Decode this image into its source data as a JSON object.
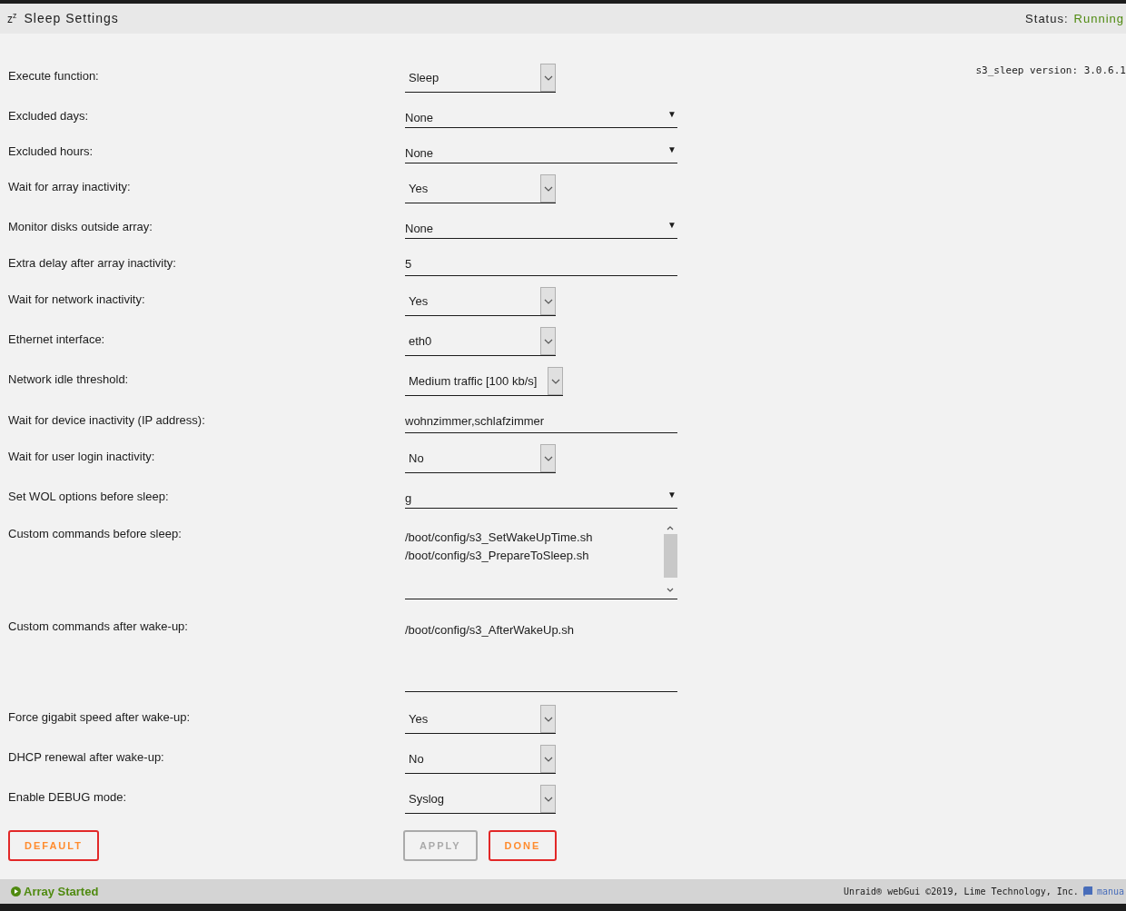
{
  "header": {
    "icon": "z$^{z}$",
    "title": "Sleep Settings",
    "status_label": "Status:",
    "status_value": "Running"
  },
  "version": "s3_sleep version: 3.0.6.1",
  "settings": [
    {
      "label": "Execute function:",
      "kind": "select",
      "value": "Sleep"
    },
    {
      "label": "Excluded days:",
      "kind": "multiselect",
      "value": "None",
      "arrow": "▼"
    },
    {
      "label": "Excluded hours:",
      "kind": "multiselect",
      "value": "None",
      "arrow": "▼"
    },
    {
      "label": "Wait for array inactivity:",
      "kind": "select",
      "value": "Yes"
    },
    {
      "label": "Monitor disks outside array:",
      "kind": "multiselect",
      "value": "None",
      "arrow": "▼"
    },
    {
      "label": "Extra delay after array inactivity:",
      "kind": "text",
      "value": "5"
    },
    {
      "label": "Wait for network inactivity:",
      "kind": "select",
      "value": "Yes"
    },
    {
      "label": "Ethernet interface:",
      "kind": "select",
      "value": "eth0"
    },
    {
      "label": "Network idle threshold:",
      "kind": "select",
      "value": "Medium traffic [100 kb/s]"
    },
    {
      "label": "Wait for device inactivity (IP address):",
      "kind": "text",
      "value": "wohnzimmer,schlafzimmer"
    },
    {
      "label": "Wait for user login inactivity:",
      "kind": "select",
      "value": "No"
    },
    {
      "label": "Set WOL options before sleep:",
      "kind": "multiselect",
      "value": "g",
      "arrow": "▼"
    },
    {
      "label": "Custom commands before sleep:",
      "kind": "textarea",
      "lines": [
        "/boot/config/s3_SetWakeUpTime.sh",
        "/boot/config/s3_PrepareToSleep.sh"
      ],
      "scrollbar": true
    },
    {
      "label": "Custom commands after wake-up:",
      "kind": "textarea",
      "lines": [
        "/boot/config/s3_AfterWakeUp.sh"
      ],
      "scrollbar": false
    },
    {
      "label": "Force gigabit speed after wake-up:",
      "kind": "select",
      "value": "Yes"
    },
    {
      "label": "DHCP renewal after wake-up:",
      "kind": "select",
      "value": "No"
    },
    {
      "label": "Enable DEBUG mode:",
      "kind": "select",
      "value": "Syslog"
    }
  ],
  "buttons": [
    {
      "label": "DEFAULT",
      "disabled": false
    },
    {
      "label": "APPLY",
      "disabled": true
    },
    {
      "label": "DONE",
      "disabled": false
    }
  ],
  "footer": {
    "status": "Array Started",
    "copyright": "Unraid® webGui ©2019, Lime Technology, Inc.",
    "manual": "manua"
  }
}
